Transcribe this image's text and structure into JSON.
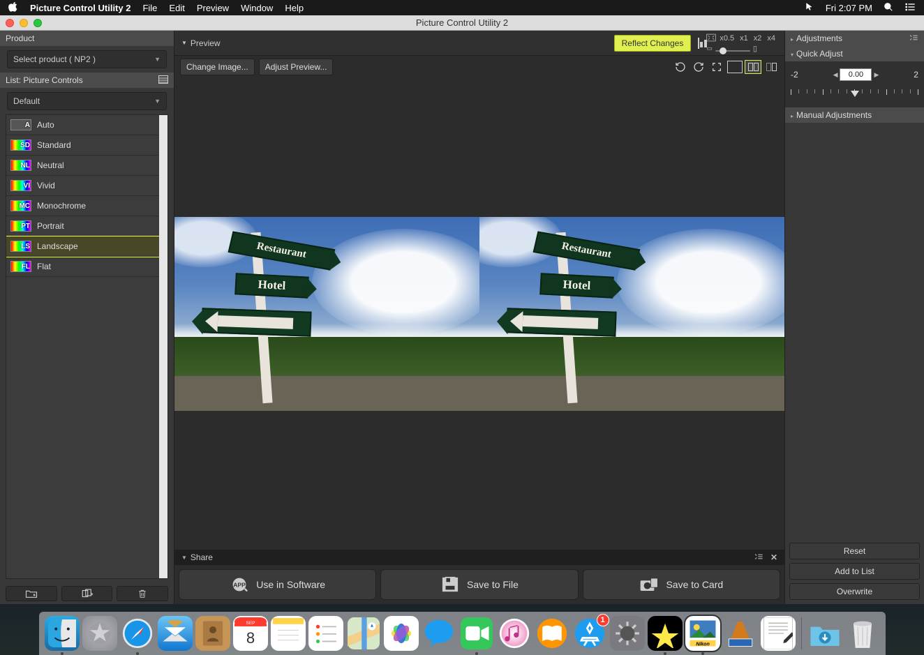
{
  "menubar": {
    "app_name": "Picture Control Utility 2",
    "menus": [
      "File",
      "Edit",
      "Preview",
      "Window",
      "Help"
    ],
    "clock": "Fri 2:07 PM"
  },
  "window": {
    "title": "Picture Control Utility 2"
  },
  "sidebar_left": {
    "product_label": "Product",
    "product_dropdown": "Select product ( NP2 )",
    "list_label": "List: Picture Controls",
    "list_dropdown": "Default",
    "items": [
      {
        "abbr": "A",
        "label": "Auto",
        "auto": true
      },
      {
        "abbr": "SD",
        "label": "Standard"
      },
      {
        "abbr": "NL",
        "label": "Neutral"
      },
      {
        "abbr": "VI",
        "label": "Vivid"
      },
      {
        "abbr": "MC",
        "label": "Monochrome"
      },
      {
        "abbr": "PT",
        "label": "Portrait"
      },
      {
        "abbr": "LS",
        "label": "Landscape",
        "selected": true
      },
      {
        "abbr": "FL",
        "label": "Flat"
      }
    ]
  },
  "center": {
    "preview_label": "Preview",
    "reflect_label": "Reflect Changes",
    "zoom_steps": [
      "x0.5",
      "x1",
      "x2",
      "x4"
    ],
    "change_image_label": "Change Image...",
    "adjust_preview_label": "Adjust Preview...",
    "share_label": "Share",
    "share_buttons": {
      "use_sw": "Use in Software",
      "save_file": "Save to File",
      "save_card": "Save to Card"
    },
    "sign_text": {
      "restaurant": "Restaurant",
      "hotel": "Hotel"
    }
  },
  "sidebar_right": {
    "adjustments_label": "Adjustments",
    "quick_adjust_label": "Quick Adjust",
    "qa_min": "-2",
    "qa_max": "2",
    "qa_value": "0.00",
    "manual_label": "Manual Adjustments",
    "buttons": {
      "reset": "Reset",
      "add": "Add to List",
      "overwrite": "Overwrite"
    }
  },
  "dock": {
    "badge_appstore": "1"
  }
}
